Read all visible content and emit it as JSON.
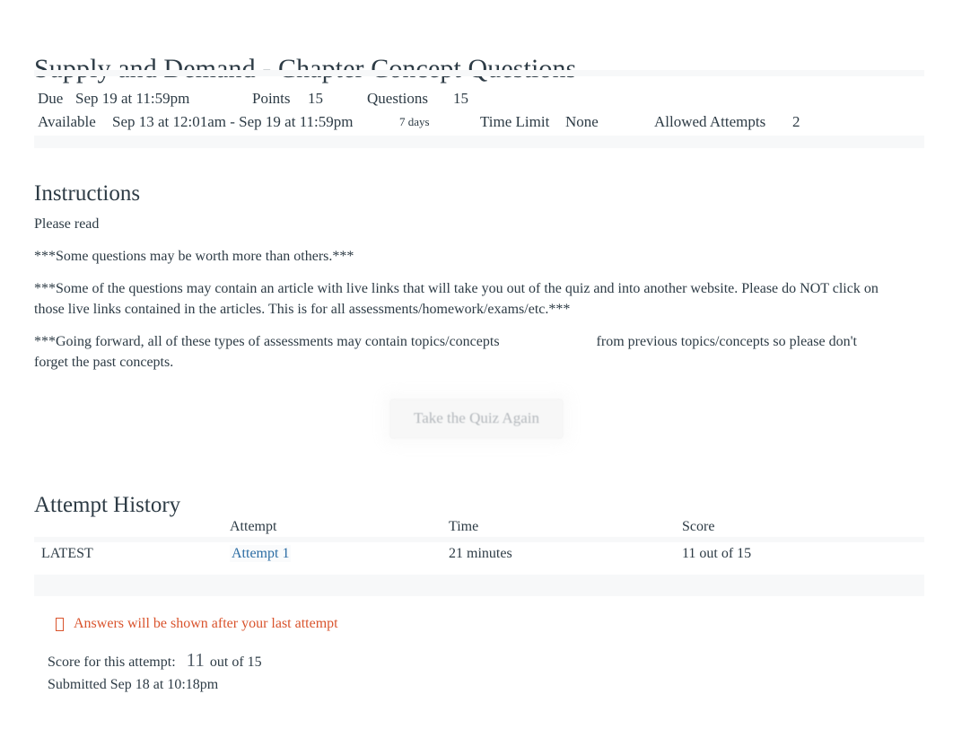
{
  "quiz": {
    "title": "Supply and Demand - Chapter Concept Questions"
  },
  "meta": {
    "due_label": "Due",
    "due_value": "Sep 19 at 11:59pm",
    "points_label": "Points",
    "points_value": "15",
    "questions_label": "Questions",
    "questions_value": "15",
    "available_label": "Available",
    "available_value": "Sep 13 at 12:01am - Sep 19 at 11:59pm",
    "available_days": "7 days",
    "time_limit_label": "Time Limit",
    "time_limit_value": "None",
    "allowed_attempts_label": "Allowed Attempts",
    "allowed_attempts_value": "2"
  },
  "instructions": {
    "heading": "Instructions",
    "p1": "Please read",
    "p2": "***Some questions may be worth more than others.***",
    "p3": "***Some of the questions may contain an article with live links that will take you out of the quiz and into another website. Please do NOT click on those live links contained in the articles. This is for all assessments/homework/exams/etc.***",
    "p4a": "***Going forward, all of these types of assessments may contain topics/concepts",
    "p4b": "from previous topics/concepts so please don't forget the past concepts."
  },
  "actions": {
    "take_quiz_again": "Take the Quiz Again"
  },
  "attempt_history": {
    "heading": "Attempt History",
    "columns": [
      "",
      "Attempt",
      "Time",
      "Score"
    ],
    "rows": [
      {
        "kept": "LATEST",
        "attempt": "Attempt 1",
        "time": "21 minutes",
        "score": "11 out of 15"
      }
    ]
  },
  "notice": {
    "icon": "warning-icon",
    "text": "Answers will be shown after your last attempt"
  },
  "score_summary": {
    "label": "Score for this attempt:",
    "value": "11",
    "out_of": "out of 15",
    "submitted": "Submitted Sep 18 at 10:18pm"
  },
  "colors": {
    "text": "#2d3b45",
    "link": "#2b6ca3",
    "warning": "#d9532c",
    "band": "#f7f8f9",
    "button_text": "#9aa0a6"
  }
}
